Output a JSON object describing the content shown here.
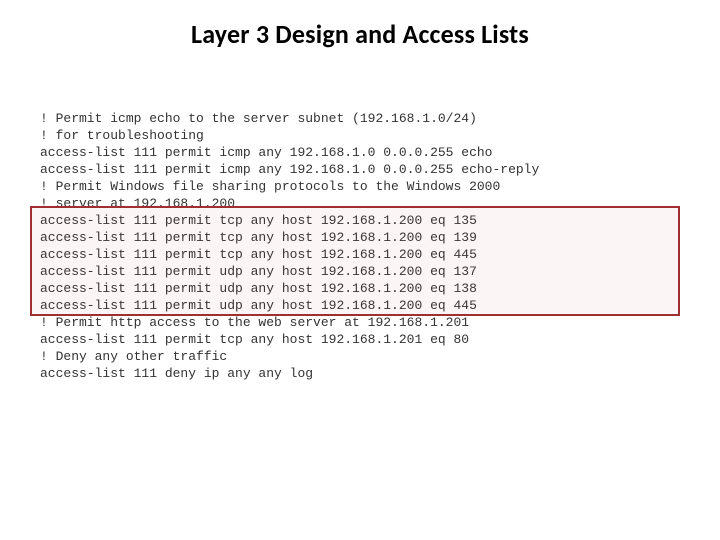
{
  "title": "Layer 3 Design and Access Lists",
  "config_lines": [
    "! Permit icmp echo to the server subnet (192.168.1.0/24)",
    "! for troubleshooting",
    "access-list 111 permit icmp any 192.168.1.0 0.0.0.255 echo",
    "access-list 111 permit icmp any 192.168.1.0 0.0.0.255 echo-reply",
    "! Permit Windows file sharing protocols to the Windows 2000",
    "! server at 192.168.1.200",
    "access-list 111 permit tcp any host 192.168.1.200 eq 135",
    "access-list 111 permit tcp any host 192.168.1.200 eq 139",
    "access-list 111 permit tcp any host 192.168.1.200 eq 445",
    "access-list 111 permit udp any host 192.168.1.200 eq 137",
    "access-list 111 permit udp any host 192.168.1.200 eq 138",
    "access-list 111 permit udp any host 192.168.1.200 eq 445",
    "! Permit http access to the web server at 192.168.1.201",
    "access-list 111 permit tcp any host 192.168.1.201 eq 80",
    "! Deny any other traffic",
    "access-list 111 deny ip any any log"
  ]
}
